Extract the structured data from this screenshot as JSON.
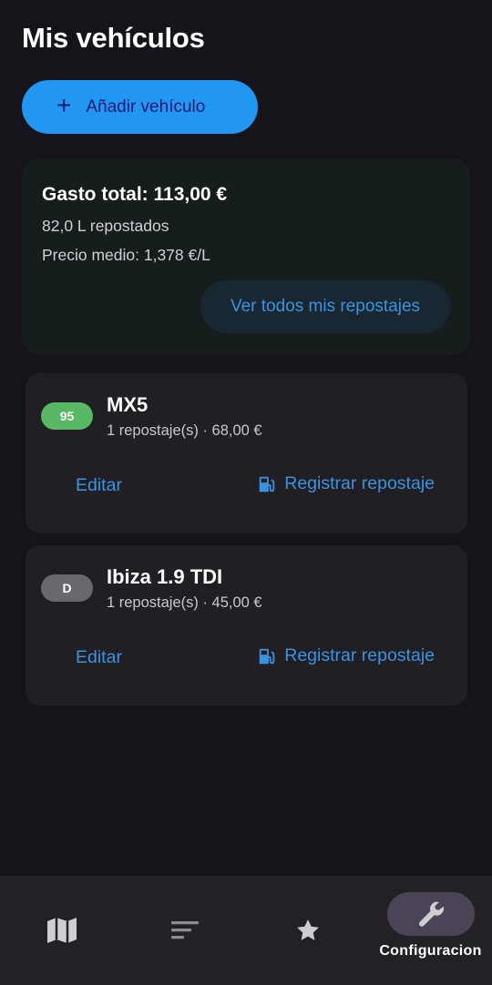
{
  "header": {
    "title": "Mis vehículos"
  },
  "actions": {
    "add_vehicle_icon": "+",
    "add_vehicle_label": "Añadir vehículo"
  },
  "summary": {
    "total": "Gasto total: 113,00 €",
    "liters": "82,0 L repostados",
    "avg_price": "Precio medio: 1,378 €/L",
    "view_all_label": "Ver todos mis repostajes"
  },
  "vehicles": [
    {
      "badge": "95",
      "badge_color": "#59b865",
      "name": "MX5",
      "meta": "1 repostaje(s) · 68,00 €",
      "edit_label": "Editar",
      "refuel_label": "Registrar repostaje",
      "refuel_icon": "fuel-pump-icon"
    },
    {
      "badge": "D",
      "badge_color": "#6a686c",
      "name": "Ibiza 1.9 TDI",
      "meta": "1 repostaje(s) · 45,00 €",
      "edit_label": "Editar",
      "refuel_label": "Registrar repostaje",
      "refuel_icon": "fuel-pump-icon"
    }
  ],
  "bottom_nav": {
    "items": [
      {
        "icon": "map-icon",
        "label": ""
      },
      {
        "icon": "list-icon",
        "label": ""
      },
      {
        "icon": "star-icon",
        "label": ""
      },
      {
        "icon": "wrench-icon",
        "label": "Configuracion",
        "active": true
      }
    ]
  },
  "colors": {
    "background": "#16141a",
    "accent": "#2196f3",
    "link": "#3b93e0",
    "card": "#221f24",
    "nav": "#232126",
    "nav_active": "#4b4457"
  }
}
